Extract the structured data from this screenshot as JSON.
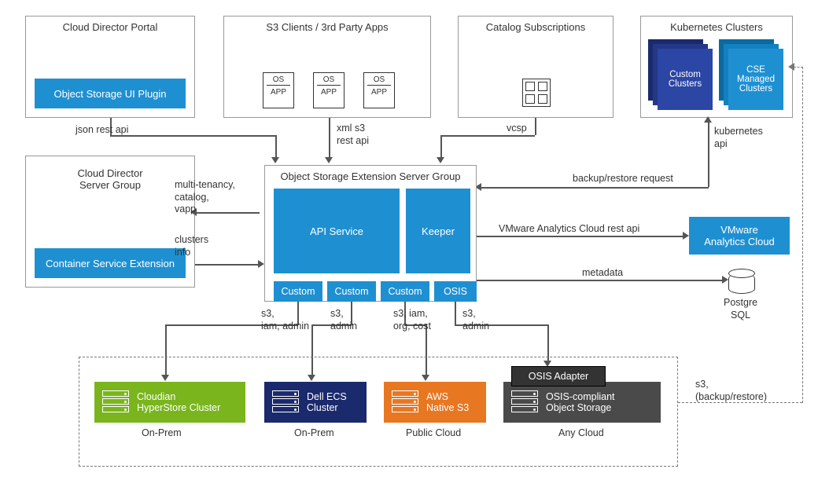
{
  "top": {
    "cdp": {
      "title": "Cloud Director Portal",
      "plugin": "Object Storage UI Plugin"
    },
    "s3": {
      "title": "S3 Clients / 3rd Party Apps",
      "os": "OS",
      "app": "APP"
    },
    "catalog": {
      "title": "Catalog Subscriptions"
    },
    "k8s": {
      "title": "Kubernetes Clusters",
      "custom": "Custom Clusters",
      "cse": "CSE Managed Clusters"
    }
  },
  "edges": {
    "json": "json rest api",
    "xml": "xml s3\nrest api",
    "vcsp": "vcsp",
    "k8sapi": "kubernetes\napi",
    "multi": "multi-tenancy,\ncatalog,\nvapp",
    "clusters": "clusters\ninfo",
    "backup": "backup/restore request",
    "metadata": "metadata",
    "vmware_api": "VMware Analytics Cloud rest api",
    "s3iam": "s3,\niam, admin",
    "s3admin": "s3,\nadmin",
    "s3iamorg": "s3, iam,\norg, cost",
    "s3admin2": "s3,\nadmin",
    "s3br": "s3,\n(backup/restore)"
  },
  "cdsg": {
    "title": "Cloud Director\nServer Group",
    "cse": "Container Service Extension"
  },
  "ose": {
    "title": "Object Storage Extension Server Group",
    "api": "API Service",
    "keeper": "Keeper",
    "c1": "Custom",
    "c2": "Custom",
    "c3": "Custom",
    "osis": "OSIS"
  },
  "right": {
    "vmware": "VMware\nAnalytics Cloud",
    "postgre": "Postgre\nSQL"
  },
  "backends": {
    "cloudian": "Cloudian\nHyperStore Cluster",
    "dell": "Dell ECS\nCluster",
    "aws": "AWS\nNative S3",
    "osis_comp": "OSIS-compliant\nObject Storage",
    "onprem": "On-Prem",
    "public": "Public Cloud",
    "any": "Any Cloud",
    "osis_adapter": "OSIS Adapter"
  }
}
